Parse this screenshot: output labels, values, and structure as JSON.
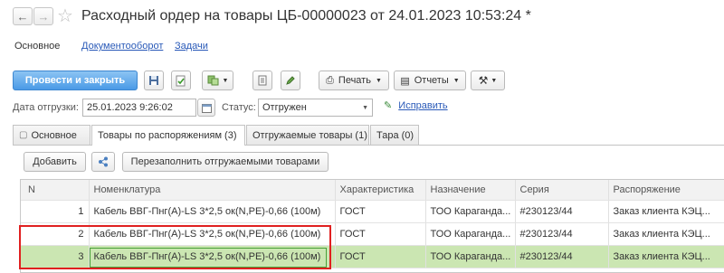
{
  "window": {
    "back_icon": "arrow-left-icon",
    "forward_icon": "arrow-right-icon",
    "star_icon": "star-icon",
    "title": "Расходный ордер на товары ЦБ-00000023 от 24.01.2023 10:53:24 *"
  },
  "nav_tabs": [
    "Основное",
    "Документооборот",
    "Задачи"
  ],
  "toolbar": {
    "post_close": "Провести и закрыть",
    "print": "Печать",
    "reports": "Отчеты"
  },
  "fields": {
    "ship_date_label": "Дата отгрузки:",
    "ship_date_value": "25.01.2023  9:26:02",
    "status_label": "Статус:",
    "status_value": "Отгружен",
    "fix_link": "Исправить"
  },
  "page_tabs": [
    "Основное",
    "Товары по распоряжениям (3)",
    "Отгружаемые товары (1)",
    "Тара (0)"
  ],
  "table_toolbar": {
    "add": "Добавить",
    "refill": "Перезаполнить отгружаемыми товарами"
  },
  "table": {
    "columns": [
      "N",
      "Номенклатура",
      "Характеристика",
      "Назначение",
      "Серия",
      "Распоряжение"
    ],
    "rows": [
      [
        "1",
        "Кабель ВВГ-Пнг(A)-LS 3*2,5 ок(N,PE)-0,66 (100м)",
        "ГОСТ",
        "ТОО Карагандa...",
        "#230123/44",
        "Заказ клиента КЭЦ..."
      ],
      [
        "2",
        "Кабель ВВГ-Пнг(A)-LS 3*2,5 ок(N,PE)-0,66 (100м)",
        "ГОСТ",
        "ТОО Карагандa...",
        "#230123/44",
        "Заказ клиента КЭЦ..."
      ],
      [
        "3",
        "Кабель ВВГ-Пнг(A)-LS 3*2,5 ок(N,PE)-0,66 (100м)",
        "ГОСТ",
        "ТОО Карагандa...",
        "#230123/44",
        "Заказ клиента КЭЦ..."
      ]
    ],
    "selected_row": 3,
    "highlight_color": "#e02020",
    "selected_color": "#cbe6b2"
  }
}
